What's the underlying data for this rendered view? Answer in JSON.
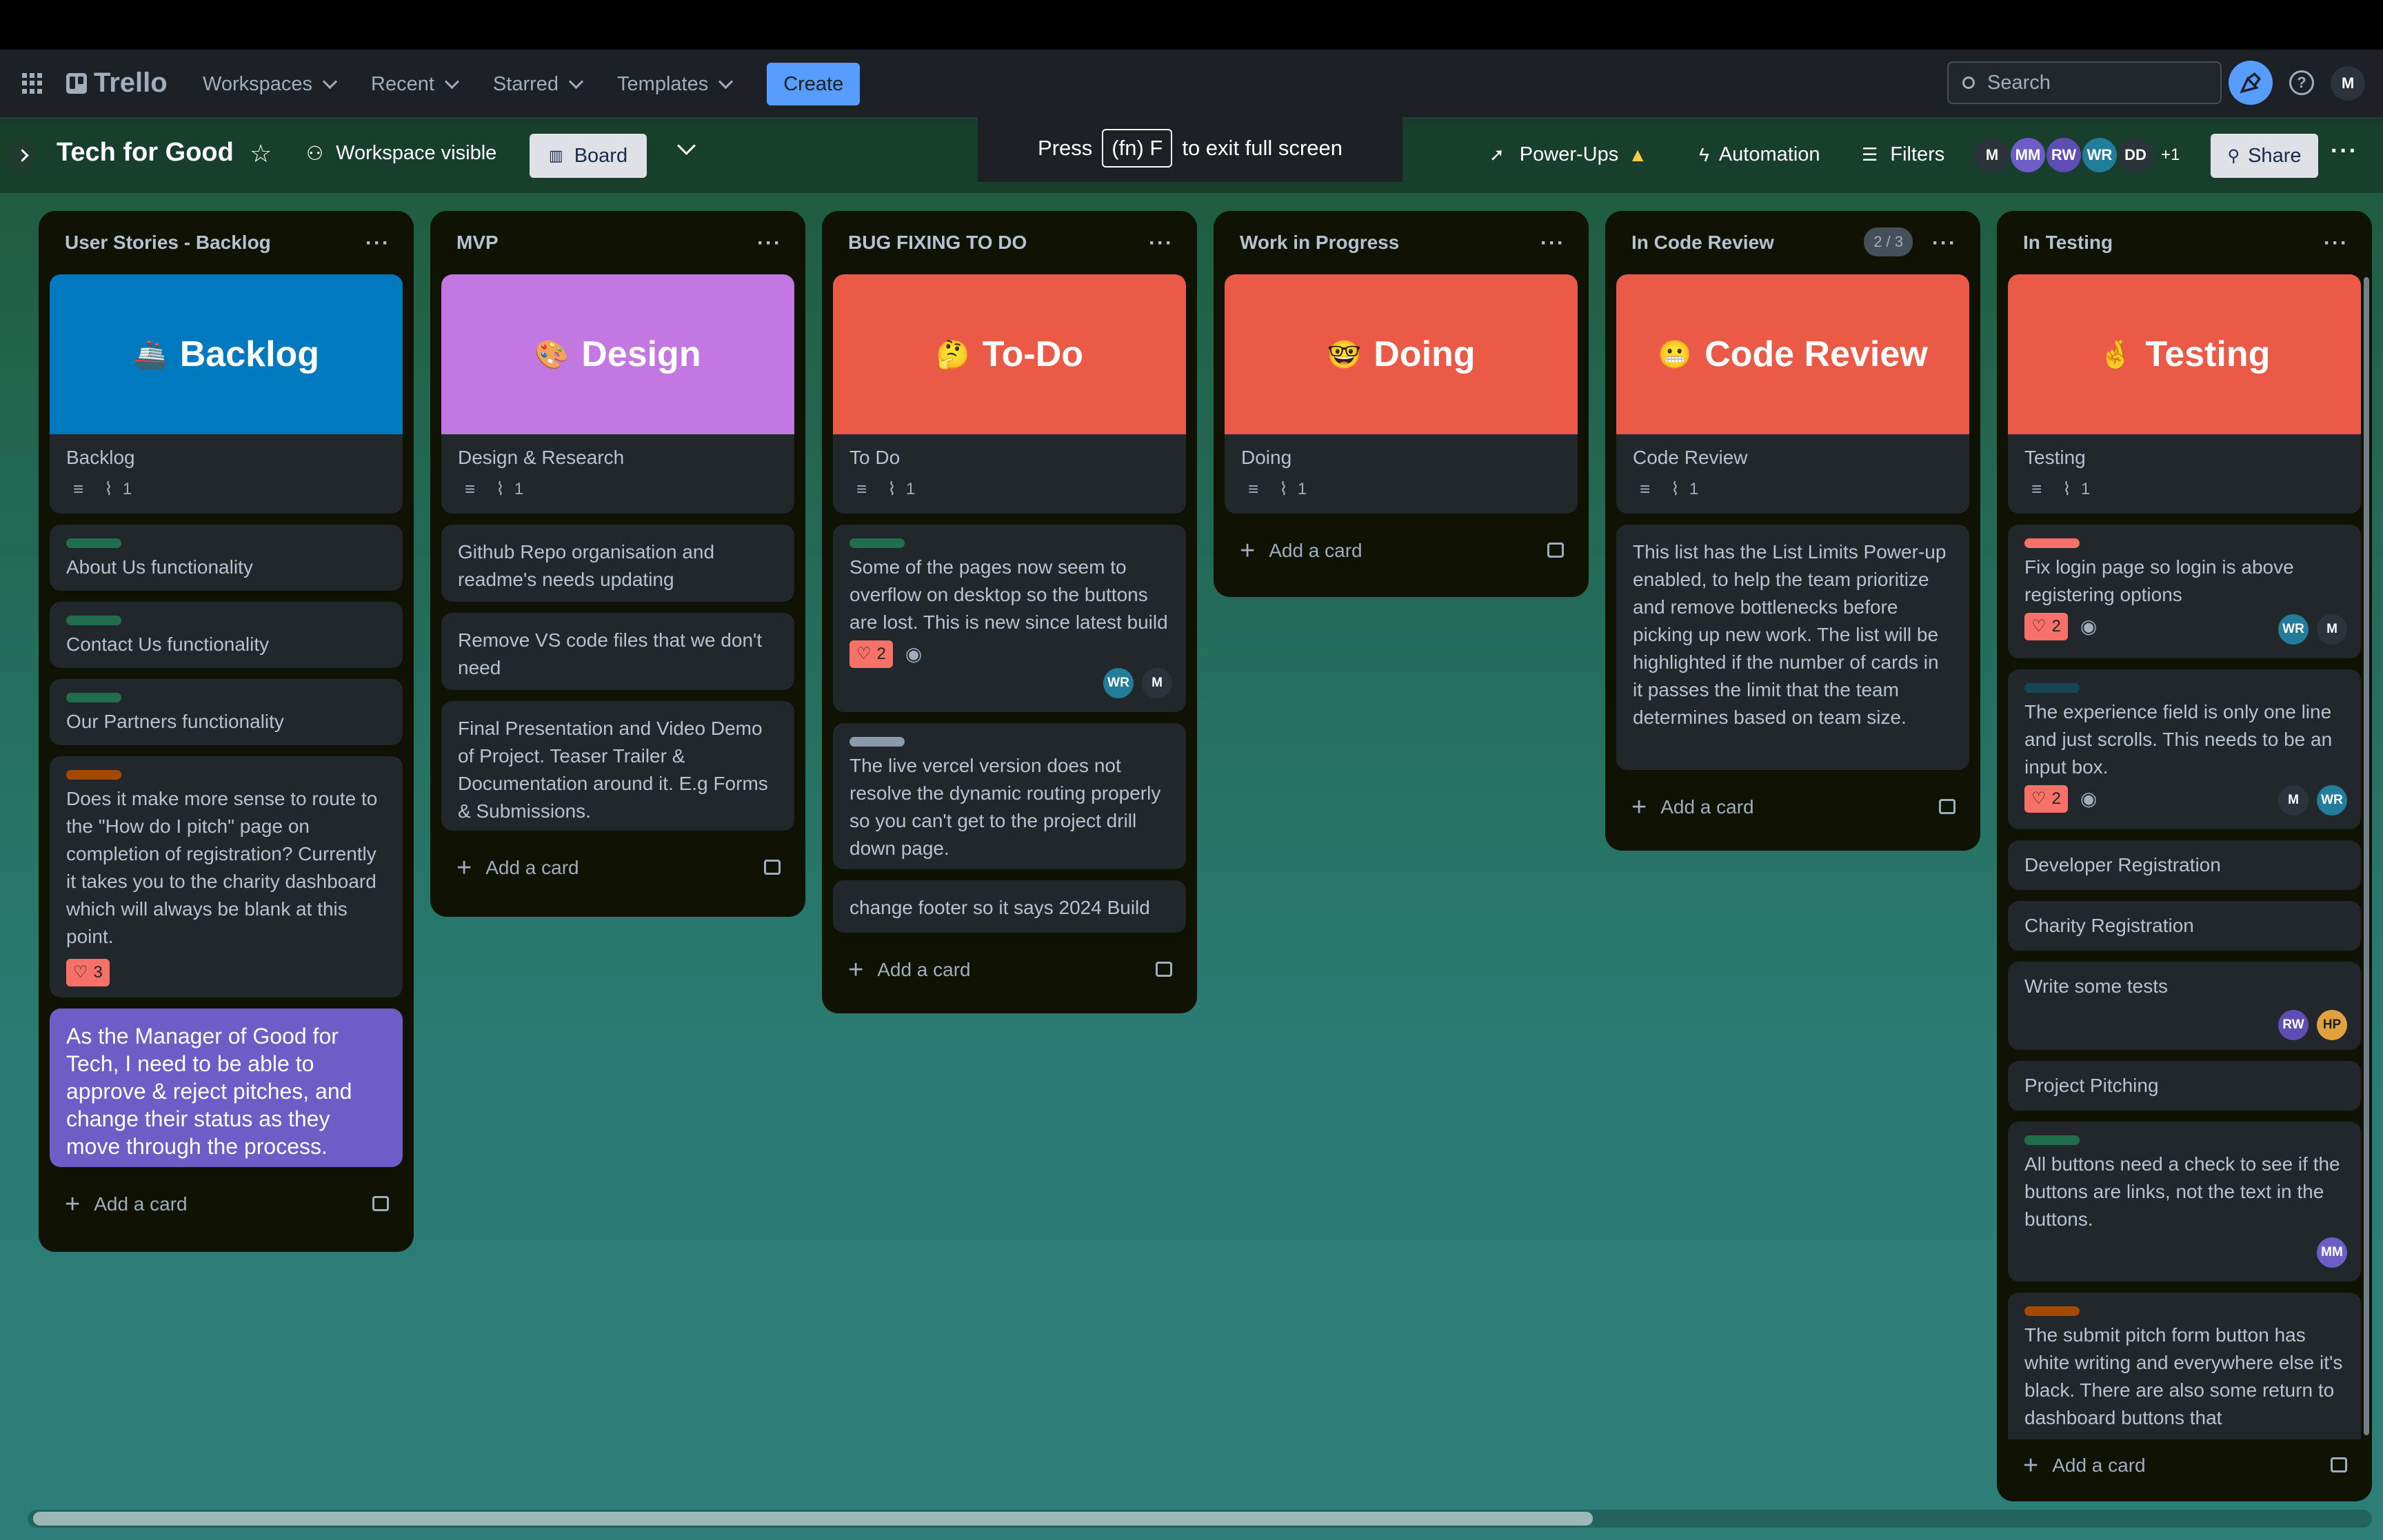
{
  "topbar": {
    "app_name": "Trello",
    "menus": [
      "Workspaces",
      "Recent",
      "Starred",
      "Templates"
    ],
    "create_label": "Create",
    "search_placeholder": "Search",
    "user_initial": "M"
  },
  "board": {
    "title": "Tech for Good",
    "visibility": "Workspace visible",
    "view_label": "Board",
    "powerups_label": "Power-Ups",
    "automation_label": "Automation",
    "filters_label": "Filters",
    "members": [
      "M",
      "MM",
      "RW",
      "WR",
      "DD"
    ],
    "extra_members": "+1",
    "share_label": "Share"
  },
  "fullscreen_toast": {
    "press": "Press",
    "key": "(fn) F",
    "rest": "to exit full screen"
  },
  "colors": {
    "accent": "#579dff",
    "vote_badge": "#f87168",
    "label_green": "#216e4e",
    "label_orange": "#a54800",
    "label_red": "#f87168",
    "label_gray": "#8c9bab",
    "label_teal": "#164555"
  },
  "lists": [
    {
      "title": "User Stories - Backlog",
      "cover_emoji": "🚢",
      "cover_title": "Backlog",
      "cover_color": "#0079bf",
      "cover_card_title": "Backlog",
      "cover_attachments": "1",
      "cards": [
        "About Us functionality",
        "Contact Us functionality",
        "Our Partners functionality",
        "Does it make more sense to route to the \"How do I pitch\" page on completion of registration? Currently it takes you to the charity dashboard which will always be blank at this point.",
        "As the Manager of Good for Tech, I need to be able to approve & reject pitches, and change their status as they move through the process."
      ],
      "votes": "3",
      "add_card": "Add a card"
    },
    {
      "title": "MVP",
      "cover_emoji": "🎨",
      "cover_title": "Design",
      "cover_color": "#c377e0",
      "cover_card_title": "Design & Research",
      "cover_attachments": "1",
      "cards": [
        "Github Repo organisation and readme's needs updating",
        "Remove VS code files that we don't need",
        "Final Presentation and Video Demo of Project. Teaser Trailer & Documentation around it. E.g Forms & Submissions."
      ],
      "add_card": "Add a card"
    },
    {
      "title": "BUG FIXING TO DO",
      "cover_emoji": "🤔",
      "cover_title": "To-Do",
      "cover_color": "#eb5a46",
      "cover_card_title": "To Do",
      "cover_attachments": "1",
      "cards": [
        "Some of the pages now seem to overflow on desktop so the buttons are lost. This is new since latest build",
        "The live vercel version does not resolve the dynamic routing properly so you can't get to the project drill down page.",
        "change footer so it says 2024 Build"
      ],
      "votes": "2",
      "members": [
        "WR",
        "M"
      ],
      "add_card": "Add a card"
    },
    {
      "title": "Work in Progress",
      "cover_emoji": "🤓",
      "cover_title": "Doing",
      "cover_color": "#eb5a46",
      "cover_card_title": "Doing",
      "cover_attachments": "1",
      "add_card": "Add a card"
    },
    {
      "title": "In Code Review",
      "limit_badge": "2 / 3",
      "cover_emoji": "😬",
      "cover_title": "Code Review",
      "cover_color": "#eb5a46",
      "cover_card_title": "Code Review",
      "cover_attachments": "1",
      "cards": [
        "This list has the List Limits Power-up enabled, to help the team prioritize and remove bottlenecks before picking up new work. The list will be highlighted if the number of cards in it passes the limit that the team determines based on team size."
      ],
      "add_card": "Add a card"
    },
    {
      "title": "In Testing",
      "cover_emoji": "🤞",
      "cover_title": "Testing",
      "cover_color": "#eb5a46",
      "cover_card_title": "Testing",
      "cover_attachments": "1",
      "cards": [
        "Fix login page so login is above registering options",
        "The experience field is only one line and just scrolls. This needs to be an input box.",
        "Developer Registration",
        "Charity Registration",
        "Write some tests",
        "Project Pitching",
        "All buttons need a check to see if the buttons are links, not the text in the buttons.",
        "The submit pitch form button has white writing and everywhere else it's black. There are also some return to dashboard buttons that"
      ],
      "votes": [
        "2",
        "2"
      ],
      "members_card1": [
        "WR",
        "M"
      ],
      "members_card2": [
        "M",
        "WR"
      ],
      "members_card5": [
        "RW",
        "HP"
      ],
      "members_card7": [
        "MM"
      ],
      "add_card": "Add a card"
    }
  ]
}
